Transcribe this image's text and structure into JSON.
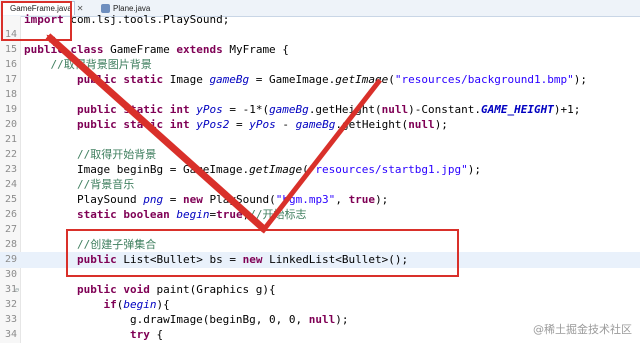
{
  "tabs": [
    {
      "label": "GameFrame.java",
      "close": "✕",
      "active": true
    },
    {
      "label": "Plane.java",
      "active": false
    }
  ],
  "lines": [
    {
      "n": "",
      "tokens": [
        [
          "kw",
          "import"
        ],
        [
          "p",
          " com.lsj.tools.PlaySound;"
        ]
      ]
    },
    {
      "n": "14",
      "tokens": []
    },
    {
      "n": "15",
      "tokens": [
        [
          "kw",
          "public class"
        ],
        [
          "p",
          " GameFrame "
        ],
        [
          "kw",
          "extends"
        ],
        [
          "p",
          " MyFrame {"
        ]
      ]
    },
    {
      "n": "16",
      "tokens": [
        [
          "p",
          "    "
        ],
        [
          "cm",
          "//取得背景图片背景"
        ]
      ]
    },
    {
      "n": "17",
      "tokens": [
        [
          "p",
          "        "
        ],
        [
          "kw",
          "public static"
        ],
        [
          "p",
          " Image "
        ],
        [
          "fld",
          "gameBg"
        ],
        [
          "p",
          " = GameImage."
        ],
        [
          "it",
          "getImage"
        ],
        [
          "p",
          "("
        ],
        [
          "str",
          "\"resources/background1.bmp\""
        ],
        [
          "p",
          ");"
        ]
      ]
    },
    {
      "n": "18",
      "tokens": []
    },
    {
      "n": "19",
      "tokens": [
        [
          "p",
          "        "
        ],
        [
          "kw",
          "public static int"
        ],
        [
          "p",
          " "
        ],
        [
          "fld",
          "yPos"
        ],
        [
          "p",
          " = -1*("
        ],
        [
          "fld",
          "gameBg"
        ],
        [
          "p",
          ".getHeight("
        ],
        [
          "kw",
          "null"
        ],
        [
          "p",
          ")-Constant."
        ],
        [
          "cst",
          "GAME_HEIGHT"
        ],
        [
          "p",
          ")+1;"
        ]
      ]
    },
    {
      "n": "20",
      "tokens": [
        [
          "p",
          "        "
        ],
        [
          "kw",
          "public static int"
        ],
        [
          "p",
          " "
        ],
        [
          "fld",
          "yPos2"
        ],
        [
          "p",
          " = "
        ],
        [
          "fld",
          "yPos"
        ],
        [
          "p",
          " - "
        ],
        [
          "fld",
          "gameBg"
        ],
        [
          "p",
          ".getHeight("
        ],
        [
          "kw",
          "null"
        ],
        [
          "p",
          ");"
        ]
      ]
    },
    {
      "n": "21",
      "tokens": []
    },
    {
      "n": "22",
      "tokens": [
        [
          "p",
          "        "
        ],
        [
          "cm",
          "//取得开始背景"
        ]
      ]
    },
    {
      "n": "23",
      "tokens": [
        [
          "p",
          "        Image beginBg = GameImage."
        ],
        [
          "it",
          "getImage"
        ],
        [
          "p",
          "("
        ],
        [
          "str",
          "\"resources/startbg1.jpg\""
        ],
        [
          "p",
          ");"
        ]
      ]
    },
    {
      "n": "24",
      "tokens": [
        [
          "p",
          "        "
        ],
        [
          "cm",
          "//背景音乐"
        ]
      ]
    },
    {
      "n": "25",
      "tokens": [
        [
          "p",
          "        PlaySound "
        ],
        [
          "fld",
          "png"
        ],
        [
          "p",
          " = "
        ],
        [
          "kw",
          "new"
        ],
        [
          "p",
          " PlaySound("
        ],
        [
          "str",
          "\"bgm.mp3\""
        ],
        [
          "p",
          ", "
        ],
        [
          "kw",
          "true"
        ],
        [
          "p",
          ");"
        ]
      ]
    },
    {
      "n": "26",
      "tokens": [
        [
          "p",
          "        "
        ],
        [
          "kw",
          "static boolean"
        ],
        [
          "p",
          " "
        ],
        [
          "fld",
          "begin"
        ],
        [
          "p",
          "="
        ],
        [
          "kw",
          "true"
        ],
        [
          "p",
          ";"
        ],
        [
          "cm",
          "//开始标志"
        ]
      ]
    },
    {
      "n": "27",
      "tokens": []
    },
    {
      "n": "28",
      "tokens": [
        [
          "p",
          "        "
        ],
        [
          "cm",
          "//创建子弹集合"
        ]
      ]
    },
    {
      "n": "29",
      "tokens": [
        [
          "p",
          "        "
        ],
        [
          "kw",
          "public"
        ],
        [
          "p",
          " List<Bullet> bs = "
        ],
        [
          "kw",
          "new"
        ],
        [
          "p",
          " LinkedList<Bullet>();"
        ]
      ],
      "highlight": true
    },
    {
      "n": "30",
      "tokens": []
    },
    {
      "n": "31",
      "tokens": [
        [
          "p",
          "        "
        ],
        [
          "kw",
          "public void"
        ],
        [
          "p",
          " paint(Graphics g){"
        ]
      ],
      "fold": "⊖"
    },
    {
      "n": "32",
      "tokens": [
        [
          "p",
          "            "
        ],
        [
          "kw",
          "if"
        ],
        [
          "p",
          "("
        ],
        [
          "fld",
          "begin"
        ],
        [
          "p",
          "){"
        ]
      ]
    },
    {
      "n": "33",
      "tokens": [
        [
          "p",
          "                g.drawImage(beginBg, 0, 0, "
        ],
        [
          "kw",
          "null"
        ],
        [
          "p",
          ");"
        ]
      ]
    },
    {
      "n": "34",
      "tokens": [
        [
          "p",
          "                "
        ],
        [
          "kw",
          "try"
        ],
        [
          "p",
          " {"
        ]
      ]
    }
  ],
  "watermark": "@稀土掘金技术社区",
  "annotation_color": "#d9302a"
}
